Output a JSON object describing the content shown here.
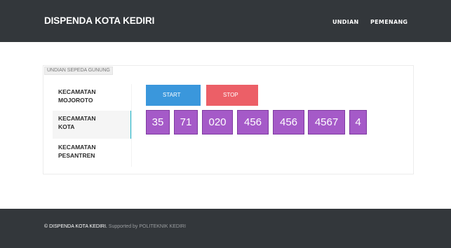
{
  "navbar": {
    "brand": "DISPENDA KOTA KEDIRI",
    "links": [
      "UNDIAN",
      "PEMENANG"
    ],
    "bg_color": "#33373b"
  },
  "panel": {
    "title": "UNDIAN SEPEDA GUNUNG",
    "menu": [
      {
        "line1": "KECAMATAN",
        "line2": "MOJOROTO",
        "active": false
      },
      {
        "line1": "KECAMATAN",
        "line2": "KOTA",
        "active": true
      },
      {
        "line1": "KECAMATAN",
        "line2": "PESANTREN",
        "active": false
      }
    ],
    "active_accent": "#1ab5c9",
    "buttons": {
      "start": {
        "label": "START",
        "color": "#3a97dc"
      },
      "stop": {
        "label": "STOP",
        "color": "#ec5f67"
      }
    },
    "numbers": [
      "35",
      "71",
      "020",
      "456",
      "456",
      "4567",
      "4"
    ],
    "number_color": "#a55ac8"
  },
  "footer": {
    "copyright": "© DISPENDA KOTA KEDIRI.",
    "supported": "Supported by POLITEKNIK KEDIRI"
  }
}
